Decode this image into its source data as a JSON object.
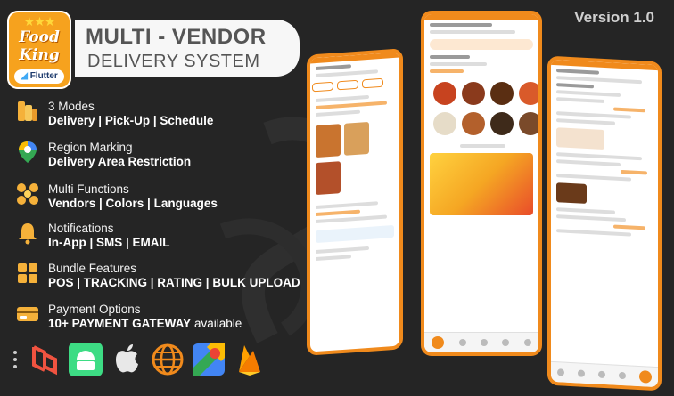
{
  "logo": {
    "brand_line1": "Food",
    "brand_line2": "King",
    "stars": "★★★",
    "flutter_label": "Flutter"
  },
  "header": {
    "title_line1": "MULTI - VENDOR",
    "title_line2": "DELIVERY SYSTEM",
    "version": "Version 1.0"
  },
  "features": [
    {
      "icon": "food-slices-icon",
      "line1": "3 Modes",
      "line2": "Delivery | Pick-Up | Schedule",
      "line2_suffix": ""
    },
    {
      "icon": "map-pin-icon",
      "line1": "Region Marking",
      "line2": "Delivery Area Restriction",
      "line2_suffix": ""
    },
    {
      "icon": "multi-function-icon",
      "line1": "Multi Functions",
      "line2": "Vendors | Colors | Languages",
      "line2_suffix": ""
    },
    {
      "icon": "bell-icon",
      "line1": "Notifications",
      "line2": "In-App | SMS | EMAIL",
      "line2_suffix": ""
    },
    {
      "icon": "bundle-grid-icon",
      "line1": "Bundle Features",
      "line2": "POS | TRACKING | RATING | BULK UPLOAD",
      "line2_suffix": ""
    },
    {
      "icon": "payment-card-icon",
      "line1": "Payment Options",
      "line2": "10+ PAYMENT GATEWAY",
      "line2_suffix": " available"
    }
  ],
  "platforms": [
    "laravel-icon",
    "android-icon",
    "apple-icon",
    "web-globe-icon",
    "google-maps-icon",
    "firebase-icon"
  ],
  "colors": {
    "accent": "#f08a1c",
    "logo_bg": "#f6a21e",
    "bg": "#252525",
    "android": "#3ddc84",
    "laravel": "#f05340"
  }
}
